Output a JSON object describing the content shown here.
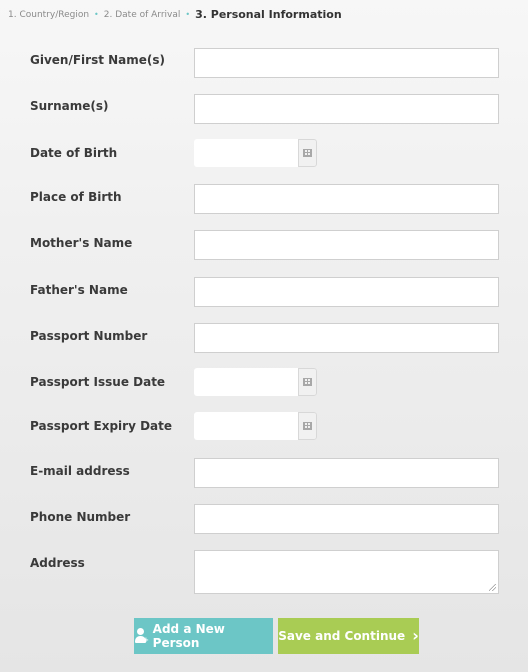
{
  "steps": {
    "step1": "1. Country/Region",
    "step2": "2. Date of Arrival",
    "step3": "3. Personal Information"
  },
  "fields": {
    "given_name": "Given/First Name(s)",
    "surname": "Surname(s)",
    "date_of_birth": "Date of Birth",
    "place_of_birth": "Place of Birth",
    "mother_name": "Mother's Name",
    "father_name": "Father's Name",
    "passport_number": "Passport Number",
    "passport_issue_date": "Passport Issue Date",
    "passport_expiry_date": "Passport Expiry Date",
    "email": "E-mail address",
    "phone": "Phone Number",
    "address": "Address"
  },
  "buttons": {
    "add_person": "Add a New Person",
    "save_continue": "Save and Continue"
  },
  "colors": {
    "teal": "#6cc6c6",
    "green": "#a9cc54"
  }
}
